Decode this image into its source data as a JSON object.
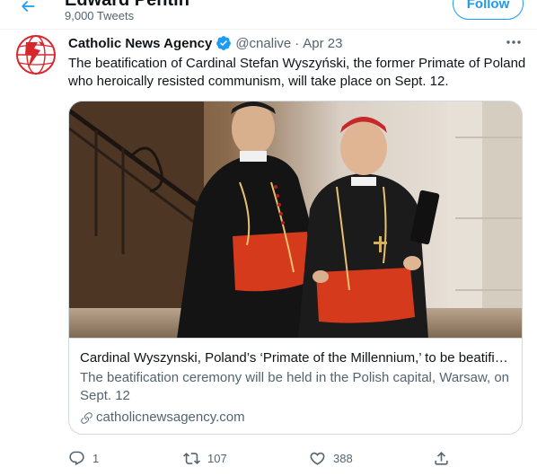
{
  "header": {
    "profile_name": "Edward Pentin",
    "tweet_count": "9,000 Tweets",
    "follow_label": "Follow"
  },
  "tweet": {
    "author_name": "Catholic News Agency",
    "handle": "@cnalive",
    "separator": "·",
    "time": "Apr 23",
    "text": "The beatification of Cardinal Stefan Wyszyński, the former Primate of Poland who heroically resisted communism, will take place on Sept. 12.",
    "card": {
      "title": "Cardinal Wyszynski, Poland’s ‘Primate of the Millennium,’ to be beatifie...",
      "description": "The beatification ceremony will be held in the Polish capital, Warsaw, on Sept. 12",
      "domain": "catholicnewsagency.com"
    },
    "actions": {
      "replies": "1",
      "retweets": "107",
      "likes": "388"
    }
  },
  "colors": {
    "accent": "#1d9bf0",
    "text_secondary": "#536471",
    "border": "#cfd9de",
    "cna_red": "#d8262c"
  },
  "icons": {
    "back": "arrow-left-icon",
    "verified": "verified-badge-icon",
    "more": "more-icon",
    "link": "link-icon",
    "reply": "reply-icon",
    "retweet": "retweet-icon",
    "like": "heart-icon",
    "share": "share-icon"
  }
}
